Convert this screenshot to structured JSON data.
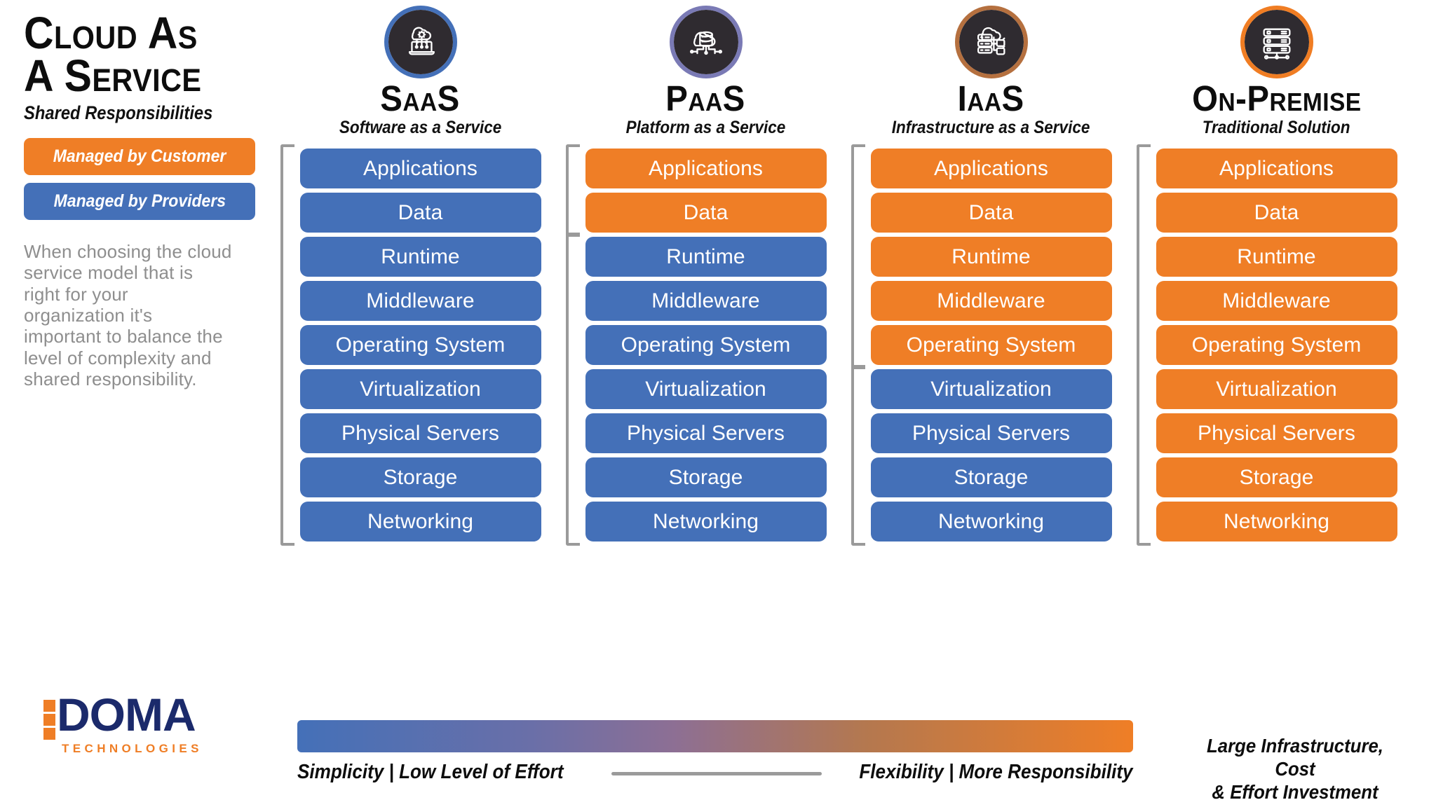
{
  "header": {
    "title_line1": "Cloud as",
    "title_line2": "a Service",
    "subtitle": "Shared Responsibilities"
  },
  "legend": {
    "customer_label": "Managed by Customer",
    "provider_label": "Managed by Providers",
    "customer_color": "#ef7e26",
    "provider_color": "#4470b8"
  },
  "intro_text": "When choosing the cloud service model that is right for your organization it's important to balance the level of complexity and shared responsibility.",
  "logo": {
    "word": "DOMA",
    "tagline": "TECHNOLOGIES",
    "word_color": "#1b2a6b",
    "accent_color": "#ef7e26"
  },
  "layers": [
    "Applications",
    "Data",
    "Runtime",
    "Middleware",
    "Operating System",
    "Virtualization",
    "Physical Servers",
    "Storage",
    "Networking"
  ],
  "columns": [
    {
      "title": "SaaS",
      "subtitle": "Software as a Service",
      "icon": "cloud-gear-laptop-icon",
      "ring_color": "#4470b8",
      "customer_managed_count": 0,
      "row_colors": [
        "blue",
        "blue",
        "blue",
        "blue",
        "blue",
        "blue",
        "blue",
        "blue",
        "blue"
      ]
    },
    {
      "title": "PaaS",
      "subtitle": "Platform as a Service",
      "icon": "cloud-database-circuit-icon",
      "ring_color": "#7a7ab5",
      "customer_managed_count": 2,
      "row_colors": [
        "orange",
        "orange",
        "blue",
        "blue",
        "blue",
        "blue",
        "blue",
        "blue",
        "blue"
      ]
    },
    {
      "title": "IaaS",
      "subtitle": "Infrastructure as a Service",
      "icon": "cloud-server-nodes-icon",
      "ring_color": "#b5703f",
      "customer_managed_count": 5,
      "row_colors": [
        "orange",
        "orange",
        "orange",
        "orange",
        "orange",
        "blue",
        "blue",
        "blue",
        "blue"
      ]
    },
    {
      "title": "On-Premise",
      "subtitle": "Traditional Solution",
      "icon": "server-rack-network-icon",
      "ring_color": "#f07d23",
      "customer_managed_count": 9,
      "row_colors": [
        "orange",
        "orange",
        "orange",
        "orange",
        "orange",
        "orange",
        "orange",
        "orange",
        "orange"
      ]
    }
  ],
  "footer": {
    "scale_left": "Simplicity | Low Level of Effort",
    "scale_right": "Flexibility | More Responsibility",
    "note_line1": "Large Infrastructure, Cost",
    "note_line2": "& Effort Investment",
    "gradient_from": "#4470b8",
    "gradient_to": "#ef7e26"
  }
}
